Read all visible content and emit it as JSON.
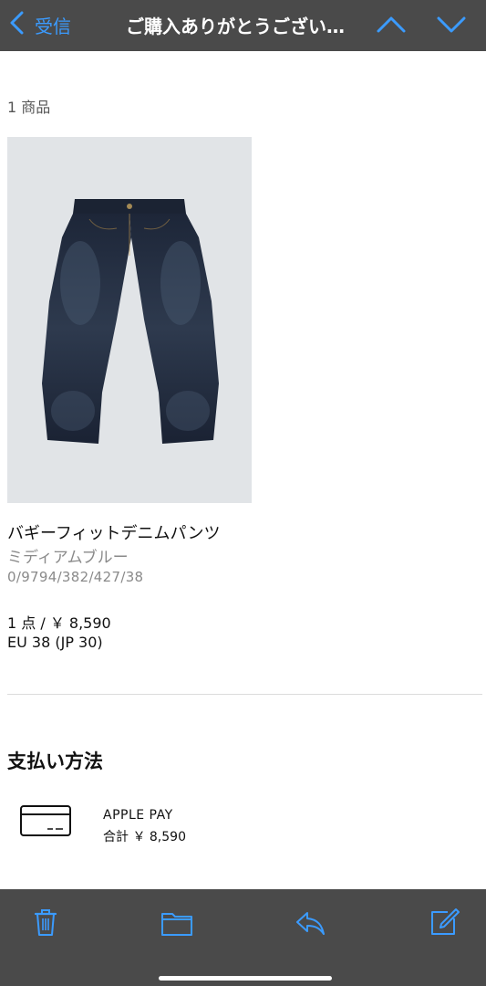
{
  "nav": {
    "back_label": "受信",
    "title": "ご購入ありがとうござい…",
    "accent_color": "#3b9bff",
    "icons": [
      "chevron-left-icon",
      "chevron-up-icon",
      "chevron-down-icon"
    ]
  },
  "order": {
    "item_count": "1 商品",
    "product": {
      "name": "バギーフィットデニムパンツ",
      "color": "ミディアムブルー",
      "reference": "0/9794/382/427/38",
      "quantity_price": "1 点 / ￥ 8,590",
      "size": "EU 38 (JP 30)",
      "image": "jeans-image"
    }
  },
  "payment": {
    "title": "支払い方法",
    "method": "APPLE PAY",
    "total": "合計 ￥ 8,590",
    "icon": "credit-card-icon"
  },
  "toolbar": {
    "icons": [
      "trash-icon",
      "folder-icon",
      "reply-icon",
      "compose-icon"
    ]
  }
}
